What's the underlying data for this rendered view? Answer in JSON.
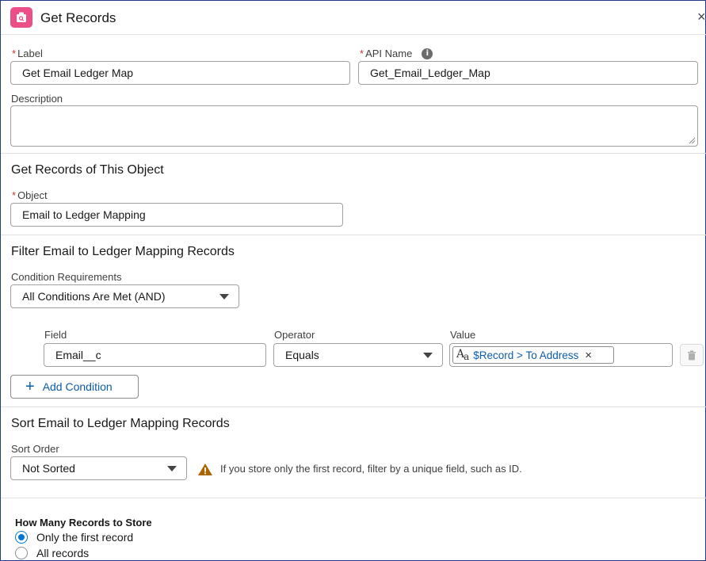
{
  "header": {
    "title": "Get Records",
    "close": "×"
  },
  "label_field": {
    "required_mark": "*",
    "label": "Label",
    "value": "Get Email Ledger Map"
  },
  "api_field": {
    "required_mark": "*",
    "label": "API Name",
    "value": "Get_Email_Ledger_Map",
    "info": "i"
  },
  "description_field": {
    "label": "Description",
    "value": ""
  },
  "object_section": {
    "title": "Get Records of This Object",
    "required_mark": "*",
    "object_label": "Object",
    "object_value": "Email to Ledger Mapping"
  },
  "filter_section": {
    "title": "Filter Email to Ledger Mapping Records",
    "condition_label": "Condition Requirements",
    "condition_value": "All Conditions Are Met (AND)",
    "field_header": "Field",
    "operator_header": "Operator",
    "value_header": "Value",
    "row": {
      "field": "Email__c",
      "operator": "Equals",
      "value_icon_main": "A",
      "value_icon_sub": "a",
      "value": "$Record > To Address",
      "value_remove": "×"
    },
    "add_condition": "Add Condition",
    "add_icon": "+"
  },
  "sort_section": {
    "title": "Sort Email to Ledger Mapping Records",
    "sort_label": "Sort Order",
    "sort_value": "Not Sorted",
    "warning_text": "If you store only the first record, filter by a unique field, such as ID."
  },
  "store_section": {
    "title": "How Many Records to Store",
    "options": [
      {
        "label": "Only the first record",
        "checked": true
      },
      {
        "label": "All records",
        "checked": false
      }
    ]
  },
  "colors": {
    "brand_pink": "#ea4f87",
    "link_blue": "#0b5cab",
    "radio_blue": "#0176d3",
    "warning_amber": "#a96404",
    "required_red": "#c23934"
  },
  "icons": {
    "header": "get-records-icon",
    "info": "info-icon",
    "trash": "trash-icon",
    "warning": "warning-icon",
    "text_type": "text-type-icon"
  }
}
